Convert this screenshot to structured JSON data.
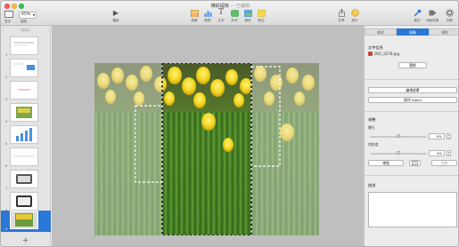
{
  "window": {
    "title": "精彩提炼",
    "title_suffix": "— 已编辑"
  },
  "toolbar": {
    "view_label": "显示",
    "zoom_value": "45%",
    "zoom_label": "缩放",
    "play_label": "播放",
    "center_items": [
      {
        "label": "表格",
        "icon": "table-icon"
      },
      {
        "label": "图表",
        "icon": "chart-icon"
      },
      {
        "label": "文本",
        "icon": "text-icon"
      },
      {
        "label": "形状",
        "icon": "shape-icon"
      },
      {
        "label": "媒体",
        "icon": "media-icon"
      },
      {
        "label": "批注",
        "icon": "comment-icon"
      }
    ],
    "right_items": [
      {
        "label": "共享",
        "icon": "share-icon"
      },
      {
        "label": "提示",
        "icon": "tips-icon"
      },
      {
        "label": "格式",
        "icon": "format-icon"
      },
      {
        "label": "动画效果",
        "icon": "animate-icon"
      },
      {
        "label": "文稿",
        "icon": "document-icon"
      }
    ]
  },
  "navigator": {
    "title": "幻灯片",
    "slides": [
      "1",
      "2",
      "3",
      "4",
      "5",
      "6",
      "7",
      "8",
      "9"
    ],
    "selected": 9
  },
  "inspector": {
    "tabs": [
      "样式",
      "图像",
      "排列"
    ],
    "active_tab": "图像",
    "file_info_label": "文件信息",
    "file_name": "DSC_0278.jpg",
    "replace_button": "替换",
    "edit_mask_button": "编辑遮罩",
    "instant_alpha_button": "即时 Alpha",
    "adjust_label": "调整",
    "exposure_label": "曝光",
    "exposure_value": "0%",
    "exposure_level": 0.5,
    "saturation_label": "饱和度",
    "saturation_value": "0%",
    "saturation_level": 0.5,
    "enhance_button": "增强",
    "reset_button": "还原",
    "description_label": "描述"
  },
  "colors": {
    "accent": "#2a77d6",
    "selection": "#2a77d6"
  }
}
